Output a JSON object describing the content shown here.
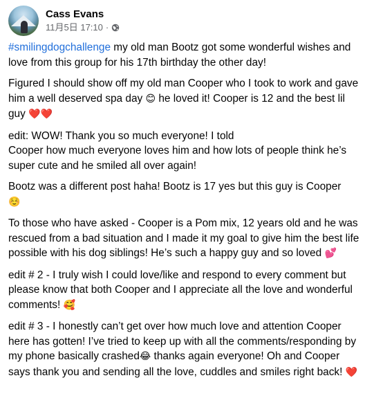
{
  "author": {
    "name": "Cass Evans"
  },
  "timestamp": "11月5日 17:10",
  "dot": "·",
  "hashtag": "#smilingdogchallenge",
  "paragraphs": [
    {
      "text": " my old man Bootz got some wonderful wishes and love from this group for his 17th birthday the other day!"
    },
    {
      "text": "Figured I should show off my old man Cooper who I took to work and gave him a well deserved spa day ",
      "emoji": "😊",
      "text2": " he loved it! Cooper is 12 and the best lil guy ",
      "emoji2": "❤️❤️"
    },
    {
      "text": "edit: WOW! Thank you so much everyone! I told\nCooper how much everyone loves him and how lots of people think he’s super cute and he smiled all over again!"
    },
    {
      "text": "Bootz was a different post haha! Bootz is 17 yes but this guy is Cooper\n",
      "emoji": "☺️"
    },
    {
      "text": "To those who have asked - Cooper is a Pom mix, 12 years old and he was rescued from a bad situation and I made it my goal to give him the best life possible with his dog siblings! He’s such a happy guy and so loved ",
      "emoji": "💕"
    },
    {
      "text": "edit # 2 - I truly wish I could love/like and respond to every comment but please know that both Cooper and I appreciate all the love and wonderful comments! ",
      "emoji": "🥰"
    },
    {
      "text": "edit # 3 - I honestly can’t get over how much love and attention Cooper here has gotten! I’ve tried to keep up with all the comments/responding by my phone basically crashed",
      "emoji": "😂",
      "text2": " thanks again everyone! Oh and Cooper says thank you and sending all the love, cuddles and smiles right back! ",
      "emoji2": "❤️"
    }
  ]
}
